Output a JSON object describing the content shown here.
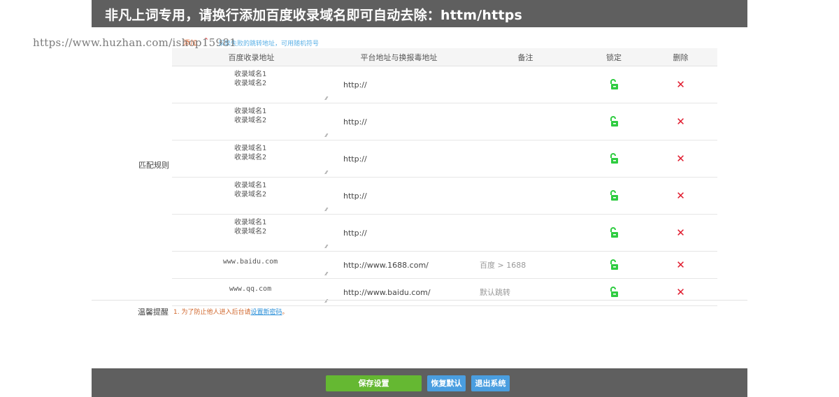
{
  "header": {
    "title": "非凡上词专用，请换行添加百度收录域名即可自动去除：httm/https"
  },
  "watermark": "https://www.huzhan.com/ishop15981",
  "add_link": "添加",
  "hint_text": "采集失败的跳转地址，可用随机符号",
  "side_label": "匹配规则",
  "columns": {
    "domain": "百度收录地址",
    "platform": "平台地址与换报毒地址",
    "note": "备注",
    "lock": "锁定",
    "delete": "删除"
  },
  "rules": [
    {
      "domain": "收录域名1\n收录域名2",
      "platform": "http://",
      "note": ""
    },
    {
      "domain": "收录域名1\n收录域名2",
      "platform": "http://",
      "note": ""
    },
    {
      "domain": "收录域名1\n收录域名2",
      "platform": "http://",
      "note": ""
    },
    {
      "domain": "收录域名1\n收录域名2",
      "platform": "http://",
      "note": ""
    },
    {
      "domain": "收录域名1\n收录域名2",
      "platform": "http://",
      "note": ""
    },
    {
      "domain": "www.baidu.com",
      "platform": "http://www.1688.com/",
      "note": "百度 > 1688"
    },
    {
      "domain": "www.qq.com",
      "platform": "http://www.baidu.com/",
      "note": "默认跳转"
    }
  ],
  "tips": {
    "label": "温馨提醒",
    "text": "1. 为了防止他人进入后台请",
    "link": "设置新密码",
    "end": "。"
  },
  "buttons": {
    "save": "保存设置",
    "reset": "恢复默认",
    "exit": "退出系统"
  },
  "colors": {
    "header_bg": "#5f5f5f",
    "save_green": "#65b832",
    "button_blue": "#4a9ee0",
    "lock_green": "#2ecc40",
    "delete_red": "#e01a2d"
  }
}
